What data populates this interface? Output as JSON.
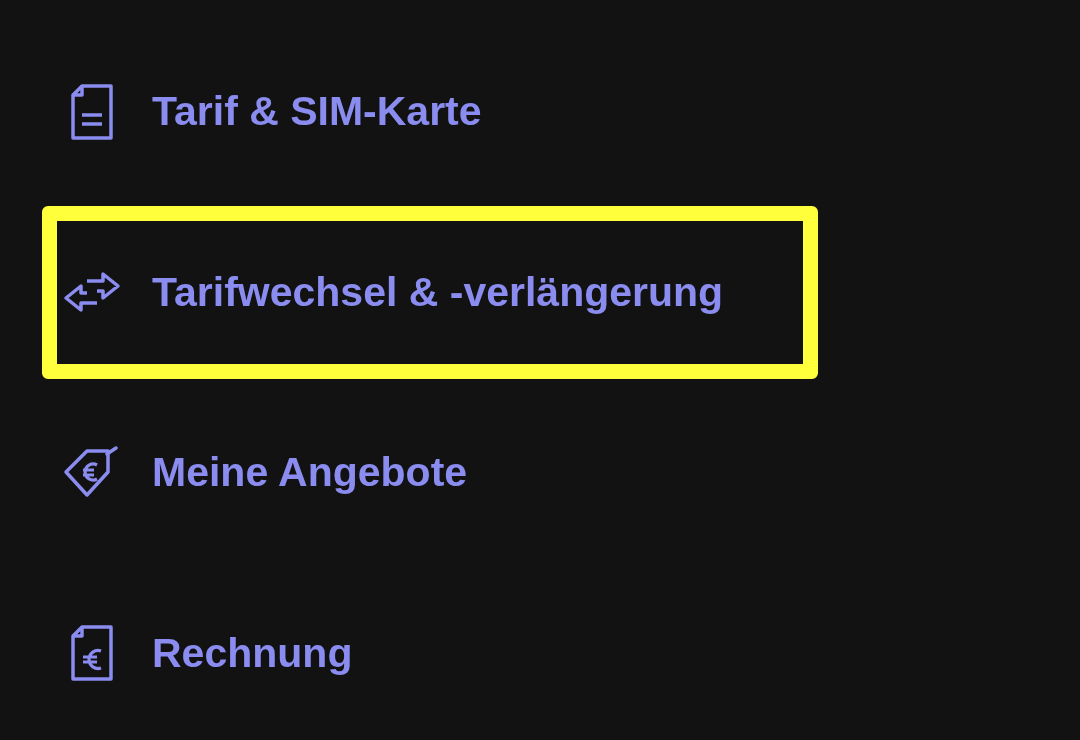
{
  "menu": {
    "items": [
      {
        "kind": "document",
        "label": "Tarif & SIM-Karte",
        "highlighted": false
      },
      {
        "kind": "swap",
        "label": "Tarifwechsel & -verlängerung",
        "highlighted": true
      },
      {
        "kind": "tag",
        "label": "Meine Angebote",
        "highlighted": false
      },
      {
        "kind": "invoice",
        "label": "Rechnung",
        "highlighted": false
      }
    ]
  }
}
